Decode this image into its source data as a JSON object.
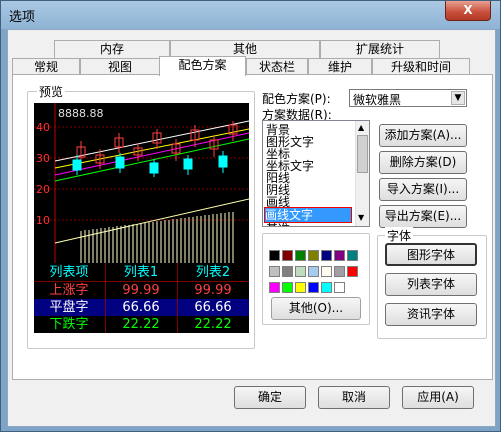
{
  "window": {
    "title": "选项",
    "close_glyph": "X"
  },
  "tabs_row1": [
    {
      "label": "内存"
    },
    {
      "label": "其他"
    },
    {
      "label": "扩展统计"
    }
  ],
  "tabs_row2": [
    {
      "label": "常规"
    },
    {
      "label": "视图"
    },
    {
      "label": "配色方案"
    },
    {
      "label": "状态栏"
    },
    {
      "label": "维护"
    },
    {
      "label": "升级和时间"
    }
  ],
  "preview": {
    "group_label": "预览",
    "price": "8888.88",
    "axis_labels": [
      "40",
      "30",
      "20",
      "10"
    ]
  },
  "table": {
    "headers": [
      "列表项",
      "列表1",
      "列表2"
    ],
    "rows": [
      {
        "label": "上涨字",
        "v1": "99.99",
        "v2": "99.99",
        "color": "#ff4040"
      },
      {
        "label": "平盘字",
        "v1": "66.66",
        "v2": "66.66",
        "color": "#ffffff"
      },
      {
        "label": "下跌字",
        "v1": "22.22",
        "v2": "22.22",
        "color": "#00ff00"
      }
    ]
  },
  "scheme": {
    "label": "配色方案(P):",
    "selected": "微软雅黑",
    "data_label": "方案数据(R):"
  },
  "list_items": [
    "背景",
    "图形文字",
    "坐标",
    "坐标文字",
    "阳线",
    "阴线",
    "画线",
    "画线文字",
    "基准"
  ],
  "list_selected": "画线文字",
  "buttons": {
    "add": "添加方案(A)...",
    "delete": "删除方案(D)",
    "import": "导入方案(I)...",
    "export": "导出方案(E)...",
    "other": "其他(O)...",
    "ok": "确定",
    "cancel": "取消",
    "apply": "应用(A)"
  },
  "font_group": {
    "label": "字体",
    "graphic": "图形字体",
    "list": "列表字体",
    "info": "资讯字体"
  },
  "palette": [
    "#000000",
    "#800000",
    "#008000",
    "#808000",
    "#000080",
    "#800080",
    "#008080",
    "#c0c0c0",
    "#808080",
    "#c0dcc0",
    "#a6caf0",
    "#fffbf0",
    "#a0a0a4",
    "#ff0000",
    "#ff00ff",
    "#00ff00",
    "#ffff00",
    "#0000ff",
    "#00ffff",
    "#ffffff"
  ]
}
